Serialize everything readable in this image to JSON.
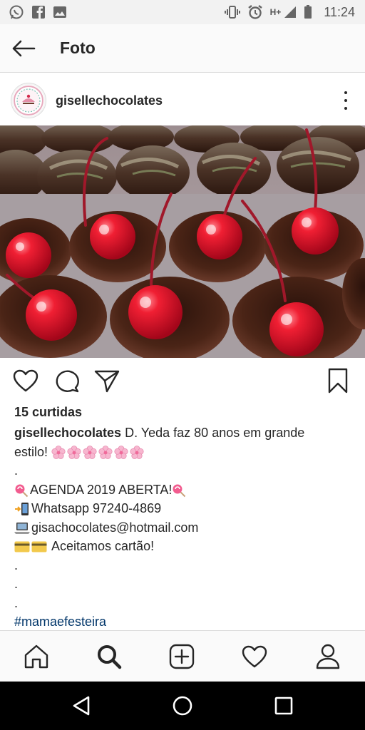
{
  "status_bar": {
    "time": "11:24",
    "network": "H+",
    "left_icons": [
      "whatsapp-icon",
      "facebook-icon",
      "gallery-icon"
    ],
    "right_icons": [
      "vibrate-icon",
      "alarm-icon",
      "signal-icon",
      "battery-icon"
    ]
  },
  "app_bar": {
    "title": "Foto"
  },
  "post": {
    "username": "gisellechocolates",
    "likes": "15 curtidas",
    "caption": {
      "username": "gisellechocolates",
      "line1": "D. Yeda faz 80 anos em grande",
      "line2": "estilo!",
      "dot1": ".",
      "agenda": "AGENDA 2019 ABERTA!",
      "whatsapp": "Whatsapp 97240-4869",
      "email": "gisachocolates@hotmail.com",
      "card": "Aceitamos cartão!",
      "dot2": ".",
      "dot3": ".",
      "dot4": ".",
      "hashtag": "#mamaefesteira"
    }
  },
  "colors": {
    "text": "#262626",
    "hashtag": "#003569",
    "divider": "#dbdbdb",
    "cherry": "#e0112a",
    "chocolate": "#3a1d12"
  }
}
